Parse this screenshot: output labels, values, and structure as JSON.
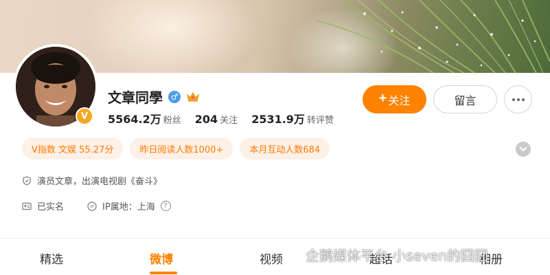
{
  "profile": {
    "name": "文章同學",
    "gender_symbol": "♂",
    "verified_badge": "V",
    "stats": [
      {
        "value": "5564.2万",
        "label": "粉丝"
      },
      {
        "value": "204",
        "label": "关注"
      },
      {
        "value": "2531.9万",
        "label": "转评赞"
      }
    ]
  },
  "actions": {
    "follow_plus": "+",
    "follow_label": "关注",
    "message_label": "留言"
  },
  "tags": [
    "V指数 文娱 55.27分",
    "昨日阅读人数1000+",
    "本月互动人数684"
  ],
  "info": {
    "bio": "演员文章，出演电视剧《奋斗》",
    "realname": "已实名",
    "ip_location": "IP属地：上海",
    "help": "?"
  },
  "tabs": [
    {
      "label": "精选",
      "active": false
    },
    {
      "label": "微博",
      "active": true
    },
    {
      "label": "视频",
      "active": false
    },
    {
      "label": "超话",
      "active": false
    },
    {
      "label": "相册",
      "active": false
    }
  ],
  "watermark": "企鹅媒体平台 小seven的囧囧",
  "colors": {
    "accent": "#ff8200",
    "tag_bg": "#fdf0e6",
    "verified": "#f6a623",
    "gender_male": "#4a9de8"
  },
  "icons": [
    "verified-v-icon",
    "male-gender-icon",
    "crown-icon",
    "shield-icon",
    "id-card-icon",
    "ip-icon",
    "help-icon",
    "more-icon",
    "chevron-down-icon",
    "watermark-logo-icon"
  ]
}
